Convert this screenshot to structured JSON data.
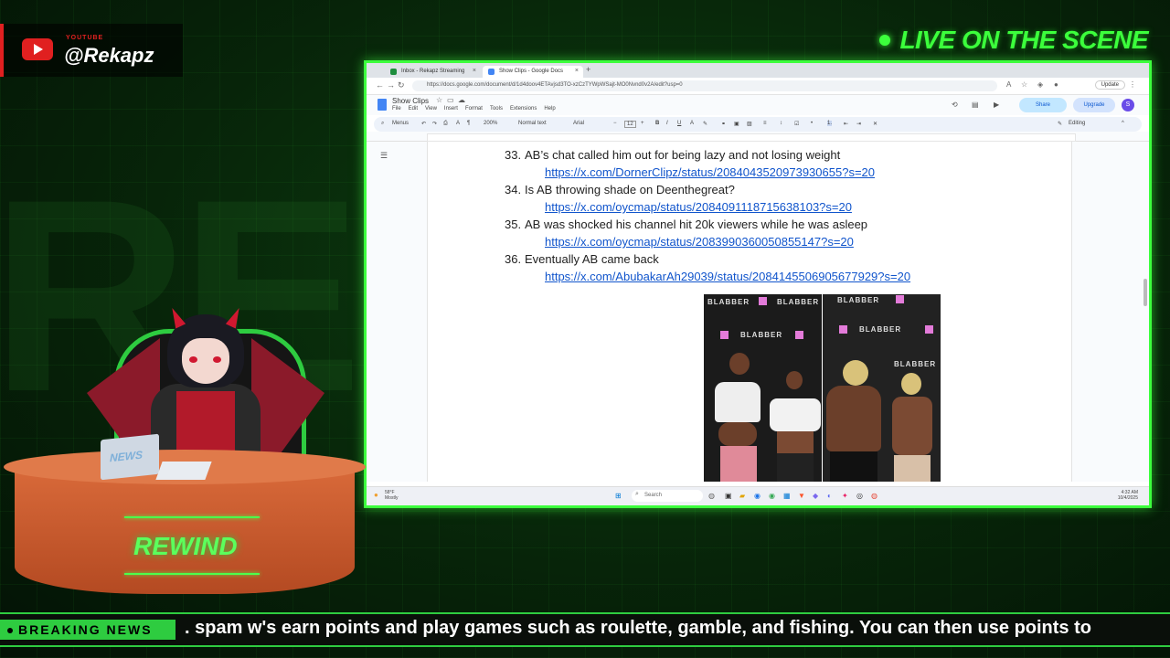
{
  "overlay": {
    "channel_small": "YOUTUBE",
    "channel_handle": "@Rekapz",
    "live_label": "LIVE ON THE SCENE",
    "desk_label": "REWIND",
    "laptop_label": "NEWS",
    "breaking_label": "BREAKING NEWS",
    "ticker_text": ". spam w's earn points and play games such as roulette, gamble, and fishing. You can then use points to",
    "colors": {
      "accent_green": "#3cff3c",
      "youtube_red": "#e02020",
      "desk_orange": "#d96a3a"
    }
  },
  "browser": {
    "tabs": [
      {
        "label": "Inbox - Rekapz Streaming",
        "icon": "sheets-icon"
      },
      {
        "label": "Show Clips - Google Docs",
        "icon": "docs-icon"
      }
    ],
    "url": "https://docs.google.com/document/d/1d4doov4ETAvjsd3TO-xzCzTYWpWSajt-MO0Nvnd0v2A/edit?usp=0",
    "update_label": "Update"
  },
  "docs": {
    "title": "Show Clips",
    "menus": [
      "File",
      "Edit",
      "View",
      "Insert",
      "Format",
      "Tools",
      "Extensions",
      "Help"
    ],
    "share_label": "Share",
    "upgrade_label": "Upgrade",
    "avatar_initial": "S",
    "toolbar": {
      "menus_label": "Menus",
      "zoom": "200%",
      "style": "Normal text",
      "font": "Arial",
      "font_size": "12",
      "mode": "Editing"
    },
    "items": [
      {
        "num": "33.",
        "text": "AB’s chat called him out for being lazy and not losing weight",
        "link": "https://x.com/DornerClipz/status/2084043520973930655?s=20"
      },
      {
        "num": "34.",
        "text": "Is AB throwing shade on Deenthegreat?",
        "link": "https://x.com/oycmap/status/2084091118715638103?s=20"
      },
      {
        "num": "35.",
        "text": "AB was shocked his channel hit 20k viewers while he was asleep",
        "link": "https://x.com/oycmap/status/2083990360050855147?s=20"
      },
      {
        "num": "36.",
        "text": "Eventually AB came back",
        "link": "https://x.com/AbubakarAh29039/status/2084145506905677929?s=20"
      }
    ],
    "photo_brand": "BLABBER"
  },
  "taskbar": {
    "weather_temp": "58°F",
    "weather_desc": "Mostly",
    "search_placeholder": "Search",
    "time": "4:32 AM",
    "date": "10/4/2025"
  }
}
